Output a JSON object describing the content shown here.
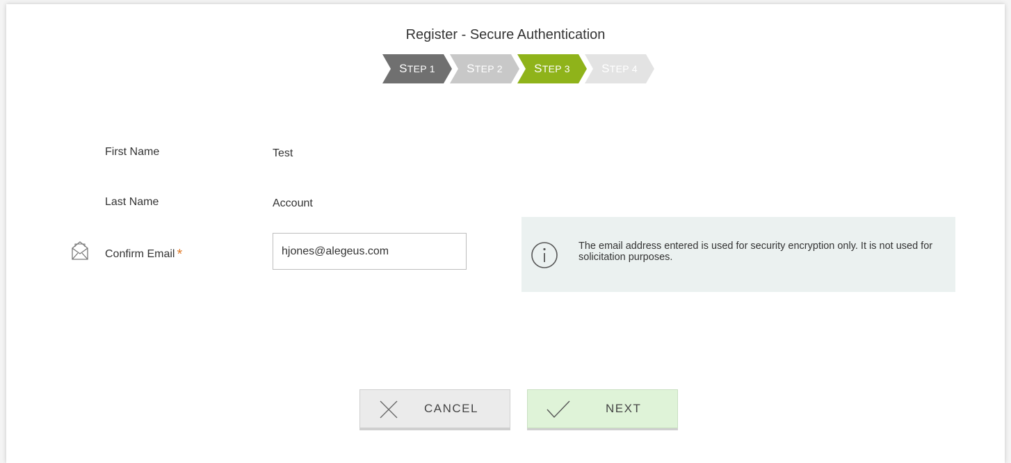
{
  "header": {
    "title": "Register - Secure Authentication"
  },
  "steps": [
    {
      "first": "S",
      "rest": "TEP 1",
      "state": "done",
      "bg": "#707070",
      "fg": "#ffffff"
    },
    {
      "first": "S",
      "rest": "TEP 2",
      "state": "inactive",
      "bg": "#c8c8c8",
      "fg": "#ffffff"
    },
    {
      "first": "S",
      "rest": "TEP 3",
      "state": "current",
      "bg": "#8fb31a",
      "fg": "#ffffff"
    },
    {
      "first": "S",
      "rest": "TEP 4",
      "state": "inactive",
      "bg": "#e3e3e3",
      "fg": "#ffffff"
    }
  ],
  "form": {
    "first_name_label": "First Name",
    "first_name_value": "Test",
    "last_name_label": "Last Name",
    "last_name_value": "Account",
    "confirm_email_label": "Confirm Email",
    "required_marker": "*",
    "confirm_email_value": "hjones@alegeus.com",
    "email_icon": "envelope-open-icon"
  },
  "info": {
    "icon": "info-icon",
    "text": "The email address entered is used for security encryption only. It is not used for solicitation purposes."
  },
  "buttons": {
    "cancel_label": "CANCEL",
    "cancel_icon": "close-icon",
    "next_label": "NEXT",
    "next_icon": "checkmark-icon"
  },
  "colors": {
    "accent_green": "#8fb31a",
    "required": "#e07b2a",
    "info_bg": "#ebf1f0",
    "next_bg": "#dff3d8",
    "cancel_bg": "#ebebeb"
  }
}
